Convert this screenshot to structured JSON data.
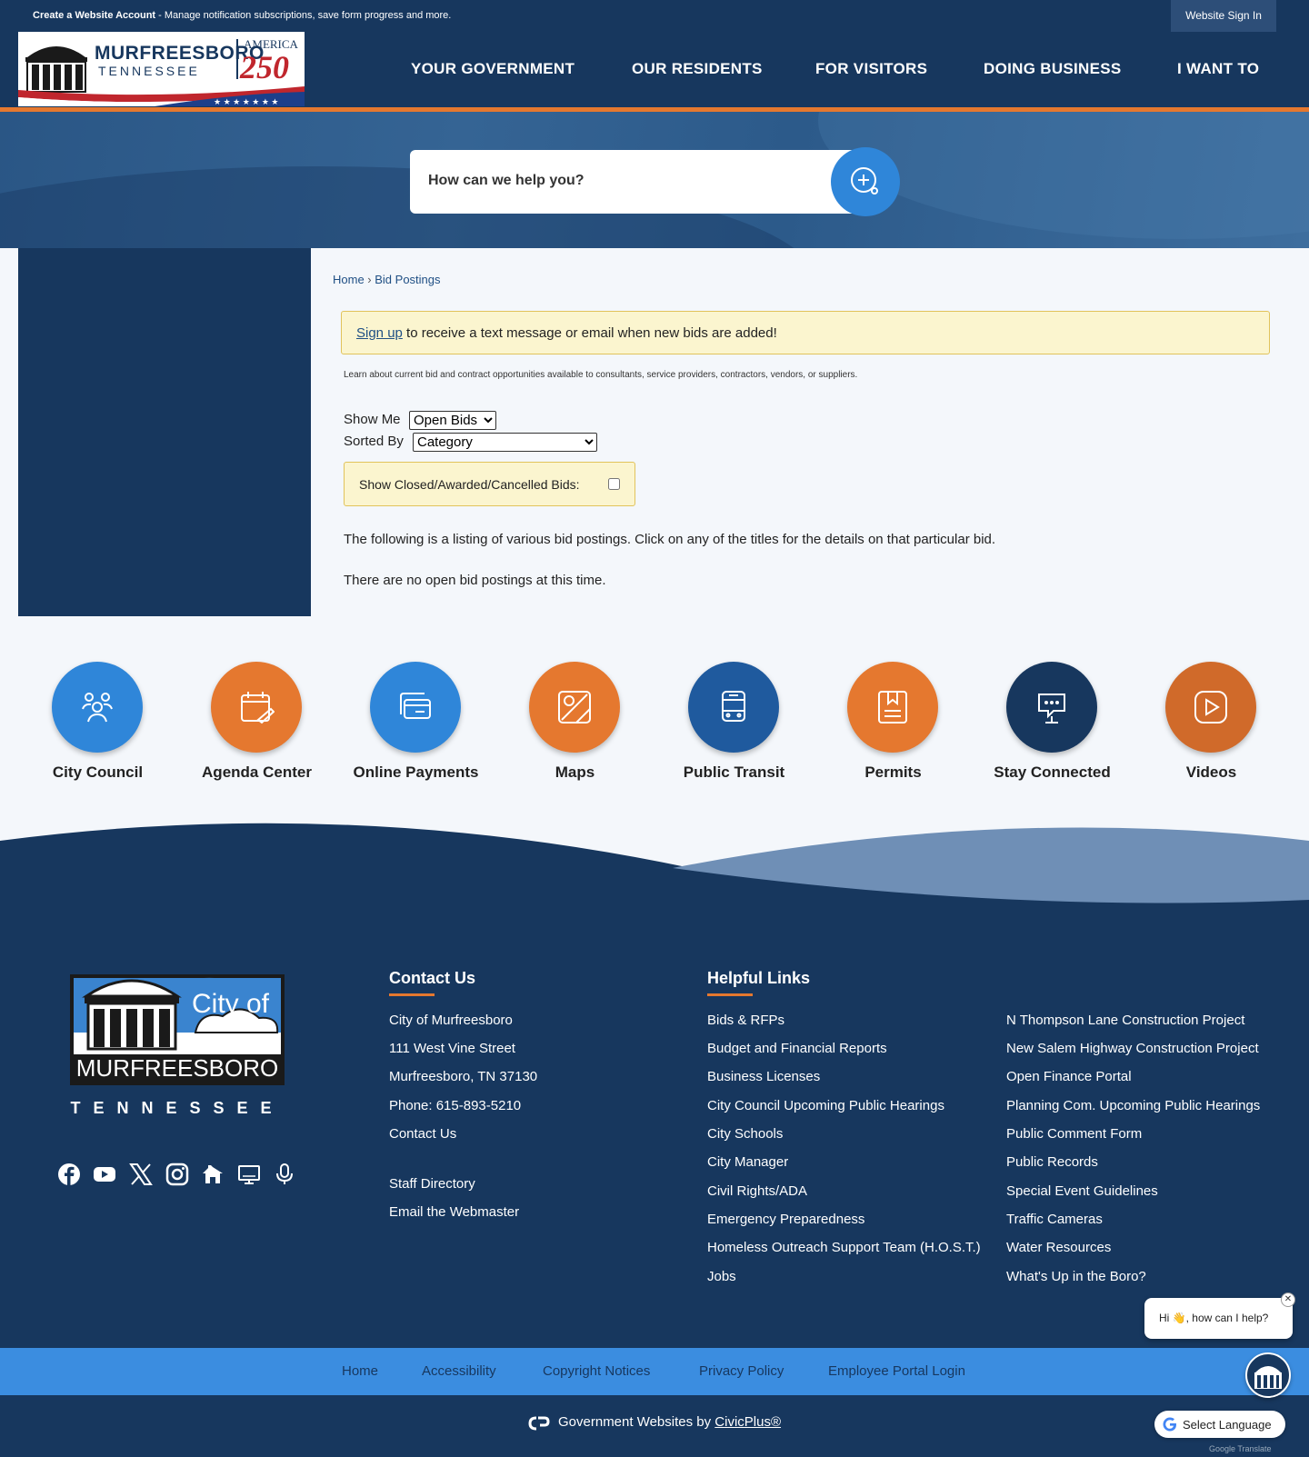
{
  "topbar": {
    "account_bold": "Create a Website Account",
    "account_rest": " - Manage notification subscriptions, save form progress and more.",
    "signin": "Website Sign In"
  },
  "logo": {
    "name": "MURFREESBORO",
    "state": "TENNESSEE",
    "america": "AMERICA",
    "year": "250"
  },
  "nav": [
    "YOUR GOVERNMENT",
    "OUR RESIDENTS",
    "FOR VISITORS",
    "DOING BUSINESS",
    "I WANT TO"
  ],
  "search": {
    "placeholder": "How can we help you?",
    "icon": "search-plus-icon"
  },
  "breadcrumb": {
    "home": "Home",
    "sep": " › ",
    "current": "Bid Postings"
  },
  "alert": {
    "link": "Sign up",
    "text": " to receive a text message or email when new bids are added!"
  },
  "intro": "Learn about current bid and contract opportunities available to consultants, service providers, contractors, vendors, or suppliers.",
  "filters": {
    "show_me_label": "Show Me",
    "show_me_value": "Open Bids",
    "sorted_by_label": "Sorted By",
    "sorted_by_value": "Category",
    "closed_label": "Show Closed/Awarded/Cancelled Bids:",
    "closed_checked": false
  },
  "listing_text": "The following is a listing of various bid postings. Click on any of the titles for the details on that particular bid.",
  "no_bids_text": "There are no open bid postings at this time.",
  "quick_links": [
    {
      "label": "City Council",
      "icon": "people-icon",
      "color": "#2f86d9"
    },
    {
      "label": "Agenda Center",
      "icon": "calendar-edit-icon",
      "color": "#e5782f"
    },
    {
      "label": "Online Payments",
      "icon": "payment-card-icon",
      "color": "#2f86d9"
    },
    {
      "label": "Maps",
      "icon": "map-icon",
      "color": "#e5782f"
    },
    {
      "label": "Public Transit",
      "icon": "bus-icon",
      "color": "#1f5a9e"
    },
    {
      "label": "Permits",
      "icon": "permit-icon",
      "color": "#e5782f"
    },
    {
      "label": "Stay Connected",
      "icon": "chat-screen-icon",
      "color": "#17375e"
    },
    {
      "label": "Videos",
      "icon": "play-icon",
      "color": "#d06a2a"
    }
  ],
  "footer": {
    "logo": {
      "city_of": "City of",
      "name": "MURFREESBORO",
      "state": "TENNESSEE"
    },
    "social": [
      "facebook-icon",
      "youtube-icon",
      "x-icon",
      "instagram-icon",
      "nextdoor-icon",
      "tv-icon",
      "podcast-icon"
    ],
    "contact": {
      "heading": "Contact Us",
      "lines": [
        "City of Murfreesboro",
        "111 West Vine Street",
        "Murfreesboro, TN 37130",
        "Phone: 615-893-5210",
        "Contact Us"
      ],
      "extra": [
        "Staff Directory",
        "Email the Webmaster"
      ]
    },
    "helpful": {
      "heading": "Helpful Links",
      "col1": [
        "Bids & RFPs",
        "Budget and Financial Reports",
        "Business Licenses",
        "City Council Upcoming Public Hearings",
        "City Schools",
        "City Manager",
        "Civil Rights/ADA",
        "Emergency Preparedness",
        "Homeless Outreach Support Team (H.O.S.T.)",
        "Jobs"
      ],
      "col2": [
        "N Thompson Lane Construction Project",
        "New Salem Highway Construction Project",
        "Open Finance Portal",
        "Planning Com. Upcoming Public Hearings",
        "Public Comment Form",
        "Public Records",
        "Special Event Guidelines",
        "Traffic Cameras",
        "Water Resources",
        "What's Up in the Boro?"
      ]
    }
  },
  "bottom_links": [
    "Home",
    "Accessibility",
    "Copyright Notices",
    "Privacy Policy",
    "Employee Portal Login"
  ],
  "credit": {
    "text": "Government Websites by ",
    "link": "CivicPlus®"
  },
  "chat": {
    "greeting": "Hi 👋, how can I help?",
    "close": "✕"
  },
  "language": {
    "label": "Select Language",
    "powered": "Google Translate"
  }
}
